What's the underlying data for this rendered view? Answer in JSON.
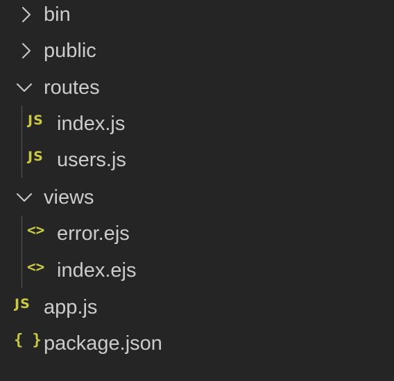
{
  "explorer": {
    "items": [
      {
        "label": "bin",
        "kind": "folder",
        "expanded": false,
        "icon": "chevron-right-icon"
      },
      {
        "label": "public",
        "kind": "folder",
        "expanded": false,
        "icon": "chevron-right-icon"
      },
      {
        "label": "routes",
        "kind": "folder",
        "expanded": true,
        "icon": "chevron-down-icon"
      },
      {
        "label": "index.js",
        "kind": "file",
        "icon": "js-file-icon",
        "badge": "JS",
        "parent": "routes"
      },
      {
        "label": "users.js",
        "kind": "file",
        "icon": "js-file-icon",
        "badge": "JS",
        "parent": "routes"
      },
      {
        "label": "views",
        "kind": "folder",
        "expanded": true,
        "icon": "chevron-down-icon"
      },
      {
        "label": "error.ejs",
        "kind": "file",
        "icon": "ejs-file-icon",
        "badge": "<>",
        "parent": "views"
      },
      {
        "label": "index.ejs",
        "kind": "file",
        "icon": "ejs-file-icon",
        "badge": "<>",
        "parent": "views"
      },
      {
        "label": "app.js",
        "kind": "file",
        "icon": "js-file-icon",
        "badge": "JS"
      },
      {
        "label": "package.json",
        "kind": "file",
        "icon": "json-file-icon",
        "badge": "{ }"
      }
    ]
  },
  "colors": {
    "background": "#252526",
    "text": "#cccccc",
    "icon_yellow": "#cbcb41",
    "chevron": "#c5c5c5",
    "indent_guide": "#585858"
  }
}
